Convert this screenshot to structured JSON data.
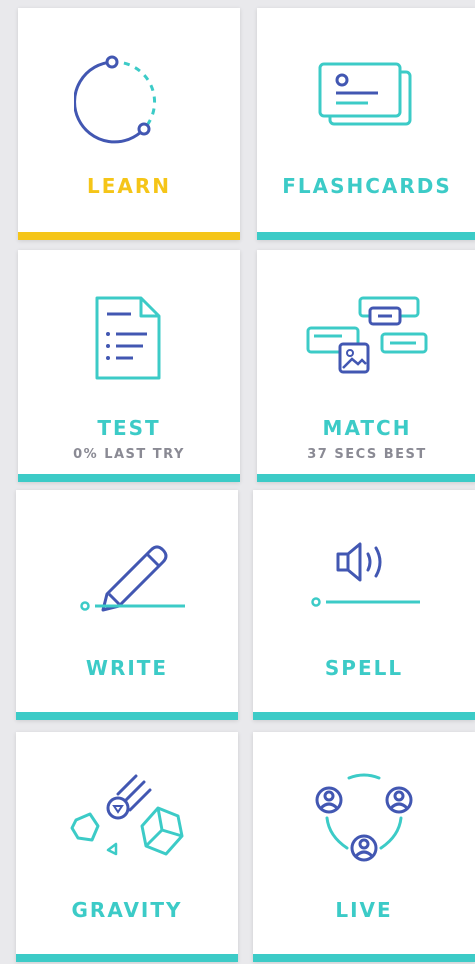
{
  "colors": {
    "teal": "#3ccbc7",
    "yellow": "#f5c518",
    "navy": "#4257b2",
    "gray_text": "#8a8a94"
  },
  "modes": [
    {
      "label": "LEARN",
      "sub": "",
      "icon": "learn-progress-icon",
      "accent": "#f5c518"
    },
    {
      "label": "FLASHCARDS",
      "sub": "",
      "icon": "flashcards-icon",
      "accent": "#3ccbc7"
    },
    {
      "label": "TEST",
      "sub": "0% LAST TRY",
      "icon": "test-document-icon",
      "accent": "#3ccbc7"
    },
    {
      "label": "MATCH",
      "sub": "37 SECS BEST",
      "icon": "match-cards-icon",
      "accent": "#3ccbc7"
    },
    {
      "label": "WRITE",
      "sub": "",
      "icon": "pencil-icon",
      "accent": "#3ccbc7"
    },
    {
      "label": "SPELL",
      "sub": "",
      "icon": "speaker-icon",
      "accent": "#3ccbc7"
    },
    {
      "label": "GRAVITY",
      "sub": "",
      "icon": "asteroid-icon",
      "accent": "#3ccbc7"
    },
    {
      "label": "LIVE",
      "sub": "",
      "icon": "live-group-icon",
      "accent": "#3ccbc7"
    }
  ]
}
